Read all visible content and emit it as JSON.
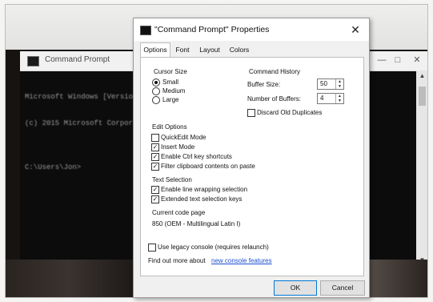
{
  "background_window": {
    "title": "Command Prompt",
    "buttons": [
      "—",
      "□",
      "✕"
    ],
    "console_lines": [
      "Microsoft Windows [Version",
      "(c) 2015 Microsoft Corporation",
      "",
      "C:\\Users\\Jon>"
    ]
  },
  "dialog": {
    "title": "\"Command Prompt\" Properties",
    "close_label": "✕",
    "tabs": [
      "Options",
      "Font",
      "Layout",
      "Colors"
    ],
    "active_tab": "Options",
    "cursor_size": {
      "heading": "Cursor Size",
      "options": [
        "Small",
        "Medium",
        "Large"
      ],
      "selected": "Small"
    },
    "command_history": {
      "heading": "Command History",
      "buffer_size_label": "Buffer Size:",
      "buffer_size_value": "50",
      "num_buffers_label": "Number of Buffers:",
      "num_buffers_value": "4",
      "discard_label": "Discard Old Duplicates",
      "discard_checked": false
    },
    "edit_options": {
      "heading": "Edit Options",
      "items": [
        {
          "label": "QuickEdit Mode",
          "checked": false
        },
        {
          "label": "Insert Mode",
          "checked": true
        },
        {
          "label": "Enable Ctrl key shortcuts",
          "checked": true
        },
        {
          "label": "Filter clipboard contents on paste",
          "checked": true
        }
      ]
    },
    "text_selection": {
      "heading": "Text Selection",
      "items": [
        {
          "label": "Enable line wrapping selection",
          "checked": true
        },
        {
          "label": "Extended text selection keys",
          "checked": true
        }
      ]
    },
    "code_page": {
      "heading": "Current code page",
      "value": "850  (OEM - Multilingual Latin I)"
    },
    "legacy_label": "Use legacy console (requires relaunch)",
    "legacy_checked": false,
    "find_out_text": "Find out more about",
    "find_out_link": "new console features",
    "ok_label": "OK",
    "cancel_label": "Cancel"
  },
  "check_mark": "✓"
}
